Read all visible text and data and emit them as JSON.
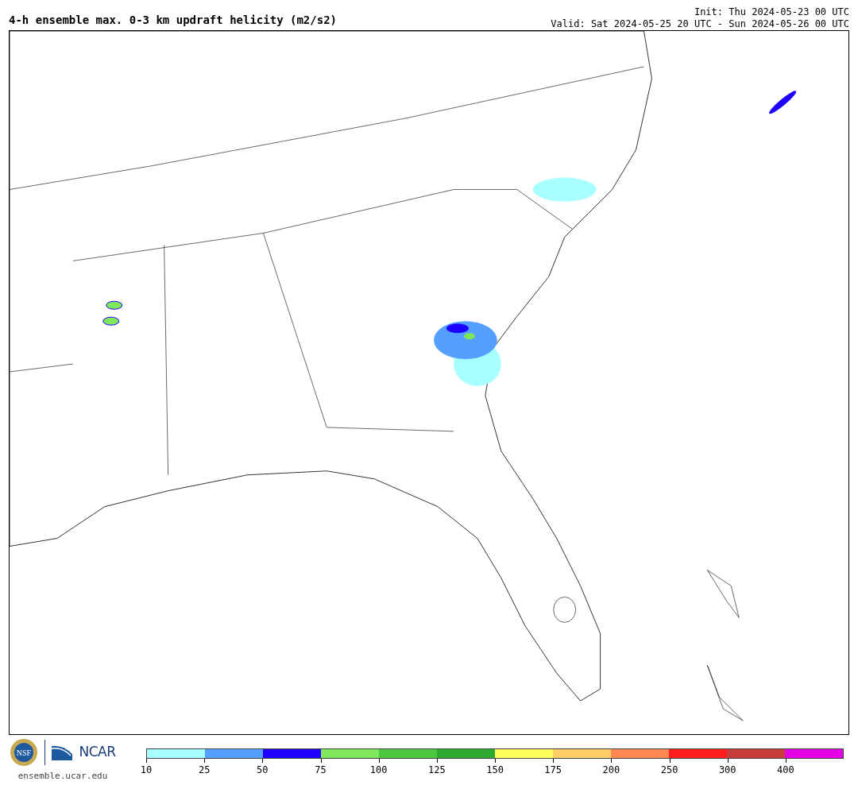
{
  "header": {
    "title": "4-h ensemble max. 0-3 km updraft helicity (m2/s2)",
    "init": "Init: Thu 2024-05-23 00 UTC",
    "valid": "Valid: Sat 2024-05-25 20 UTC - Sun 2024-05-26 00 UTC"
  },
  "footer": {
    "nsf_logo": "NSF",
    "ncar_logo": "NCAR",
    "site": "ensemble.ucar.edu"
  },
  "colorbar": {
    "bins": [
      {
        "color": "#a8ffff",
        "label": "10"
      },
      {
        "color": "#55a0ff",
        "label": "25"
      },
      {
        "color": "#1e00ff",
        "label": "50"
      },
      {
        "color": "#80e65a",
        "label": "75"
      },
      {
        "color": "#4cc83e",
        "label": "100"
      },
      {
        "color": "#2daa32",
        "label": "125"
      },
      {
        "color": "#ffff5a",
        "label": "150"
      },
      {
        "color": "#ffcc66",
        "label": "175"
      },
      {
        "color": "#ff8850",
        "label": "200"
      },
      {
        "color": "#ff1e1e",
        "label": "250"
      },
      {
        "color": "#c83c3c",
        "label": "300"
      },
      {
        "color": "#e600e6",
        "label": "400"
      }
    ]
  }
}
